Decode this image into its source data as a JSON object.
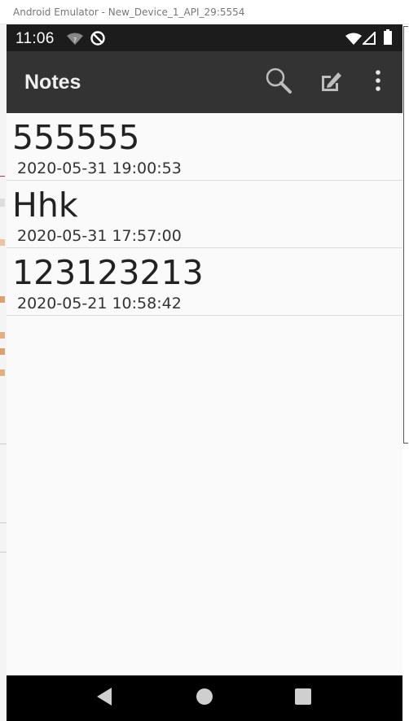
{
  "window": {
    "title": "Android Emulator - New_Device_1_API_29:5554"
  },
  "status_bar": {
    "time": "11:06"
  },
  "app_bar": {
    "title": "Notes",
    "search_icon": "search-icon",
    "compose_icon": "edit-note-icon",
    "overflow_icon": "more-vert-icon"
  },
  "notes": [
    {
      "title": "555555",
      "date": "2020-05-31 19:00:53"
    },
    {
      "title": "Hhk",
      "date": "2020-05-31 17:57:00"
    },
    {
      "title": "123123213",
      "date": "2020-05-21 10:58:42"
    }
  ],
  "colors": {
    "app_bar": "#333333",
    "status_bar": "#1c1c1c",
    "background": "#fafafa",
    "nav_bar": "#000000"
  }
}
